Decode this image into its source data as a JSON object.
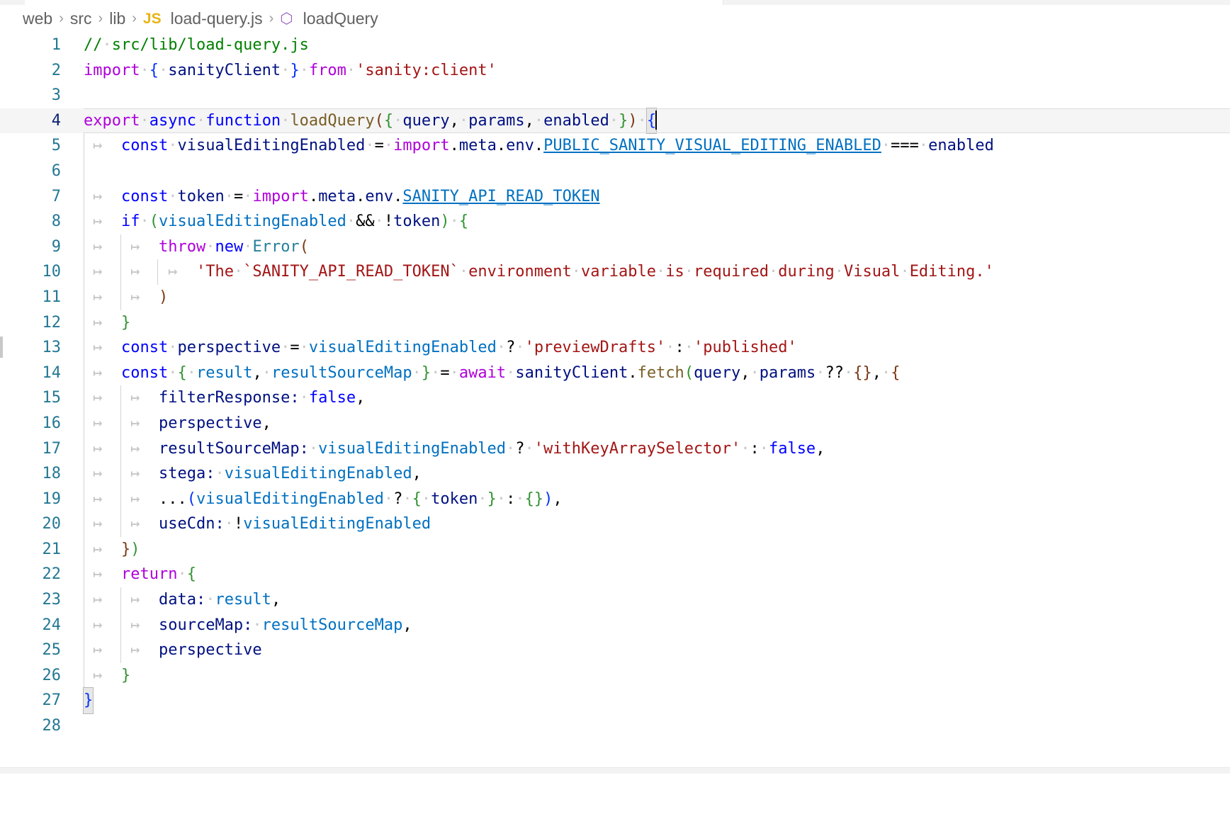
{
  "window": {
    "theme": "vscode-light",
    "accent_colors": {
      "line_number": "#237893",
      "current_line_number": "#0b216f",
      "comment": "#008000",
      "keyword": "#af00db",
      "control_keyword": "#0000ff",
      "string": "#a31515",
      "identifier": "#001080",
      "variable": "#0070c1",
      "function": "#795e26",
      "type": "#267f99",
      "active_line_bg": "#f5f5f5",
      "js_icon": "#e7b416",
      "symbol_icon": "#9b5ec4"
    }
  },
  "breadcrumb": {
    "name": "breadcrumb",
    "segments": [
      {
        "label": "web",
        "icon": null
      },
      {
        "label": "src",
        "icon": null
      },
      {
        "label": "lib",
        "icon": null
      },
      {
        "label": "load-query.js",
        "icon": "js-file-icon",
        "icon_text": "JS"
      },
      {
        "label": "loadQuery",
        "icon": "symbol-function-icon",
        "icon_text": "⬡"
      }
    ],
    "separator": "›"
  },
  "editor": {
    "file_name": "load-query.js",
    "language": "javascript",
    "cursor_line": 4,
    "total_lines": 28,
    "render_whitespace": true,
    "lines": [
      {
        "n": 1,
        "text": "// src/lib/load-query.js"
      },
      {
        "n": 2,
        "text": "import { sanityClient } from 'sanity:client'"
      },
      {
        "n": 3,
        "text": ""
      },
      {
        "n": 4,
        "text": "export async function loadQuery({ query, params, enabled }) {"
      },
      {
        "n": 5,
        "text": "    const visualEditingEnabled = import.meta.env.PUBLIC_SANITY_VISUAL_EDITING_ENABLED === enabled"
      },
      {
        "n": 6,
        "text": ""
      },
      {
        "n": 7,
        "text": "    const token = import.meta.env.SANITY_API_READ_TOKEN"
      },
      {
        "n": 8,
        "text": "    if (visualEditingEnabled && !token) {"
      },
      {
        "n": 9,
        "text": "        throw new Error("
      },
      {
        "n": 10,
        "text": "            'The `SANITY_API_READ_TOKEN` environment variable is required during Visual Editing.'"
      },
      {
        "n": 11,
        "text": "        )"
      },
      {
        "n": 12,
        "text": "    }"
      },
      {
        "n": 13,
        "text": "    const perspective = visualEditingEnabled ? 'previewDrafts' : 'published'"
      },
      {
        "n": 14,
        "text": "    const { result, resultSourceMap } = await sanityClient.fetch(query, params ?? {}, {"
      },
      {
        "n": 15,
        "text": "        filterResponse: false,"
      },
      {
        "n": 16,
        "text": "        perspective,"
      },
      {
        "n": 17,
        "text": "        resultSourceMap: visualEditingEnabled ? 'withKeyArraySelector' : false,"
      },
      {
        "n": 18,
        "text": "        stega: visualEditingEnabled,"
      },
      {
        "n": 19,
        "text": "        ...(visualEditingEnabled ? { token } : {}),"
      },
      {
        "n": 20,
        "text": "        useCdn: !visualEditingEnabled"
      },
      {
        "n": 21,
        "text": "    })"
      },
      {
        "n": 22,
        "text": "    return {"
      },
      {
        "n": 23,
        "text": "        data: result,"
      },
      {
        "n": 24,
        "text": "        sourceMap: resultSourceMap,"
      },
      {
        "n": 25,
        "text": "        perspective"
      },
      {
        "n": 26,
        "text": "    }"
      },
      {
        "n": 27,
        "text": "}"
      },
      {
        "n": 28,
        "text": ""
      }
    ],
    "bracket_match": {
      "open_line": 4,
      "open_char": "{",
      "close_line": 27,
      "close_char": "}"
    }
  }
}
